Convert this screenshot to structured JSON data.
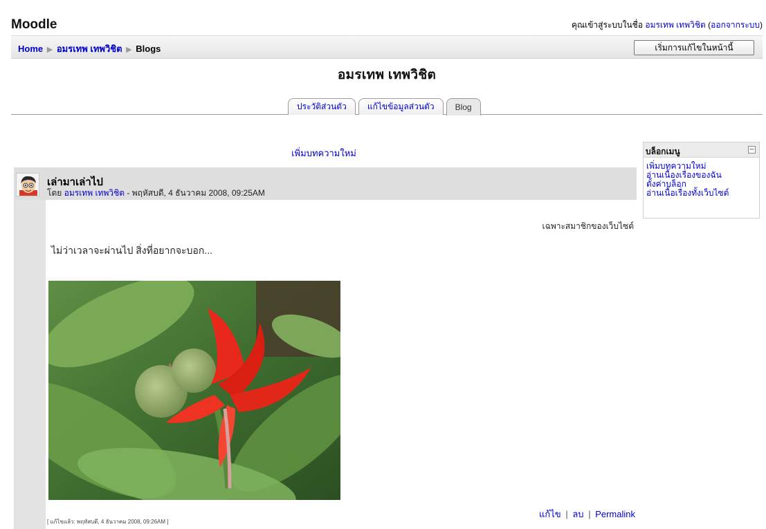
{
  "site": {
    "logo": "Moodle",
    "login_prefix": "คุณเข้าสู่ระบบในชื่อ",
    "login_user": "อมรเทพ เทพวิชิต",
    "logout_label": "ออกจากระบบ"
  },
  "navbar": {
    "breadcrumb": [
      {
        "label": "Home"
      },
      {
        "label": "อมรเทพ เทพวิชิต"
      },
      {
        "label": "Blogs"
      }
    ],
    "separator": "▶",
    "edit_button": "เริ่มการแก้ไขในหน้านี้"
  },
  "page": {
    "title": "อมรเทพ เทพวิชิต"
  },
  "tabs": [
    {
      "label": "ประวัติส่วนตัว",
      "active": false
    },
    {
      "label": "แก้ไขข้อมูลส่วนตัว",
      "active": false
    },
    {
      "label": "Blog",
      "active": true
    }
  ],
  "main": {
    "add_post": "เพิ่มบทความใหม่"
  },
  "post": {
    "title": "เล่ามาเล่าไป",
    "by_label": "โดย",
    "author": "อมรเทพ เทพวิชิต",
    "date": "- พฤหัสบดี, 4 ธันวาคม 2008, 09:25AM",
    "visibility": "เฉพาะสมาชิกของเว็บไซต์",
    "body": "ไม่ว่าเวลาจะผ่านไป สิ่งที่อยากจะบอก...",
    "actions": {
      "edit": "แก้ไข",
      "delete": "ลบ",
      "permalink": "Permalink",
      "separator": "|"
    },
    "last_edited": "[ แก้ไขแล้ว: พฤหัสบดี, 4 ธันวาคม 2008, 09:26AM ]"
  },
  "blog_menu": {
    "title": "บล็อกเมนู",
    "collapse_symbol": "−",
    "items": [
      {
        "label": "เพิ่มบทความใหม่"
      },
      {
        "label": "อ่านเนื้องเรื่องของฉัน"
      },
      {
        "label": "ตั้งค่าบล็อก"
      },
      {
        "label": "อ่านเนื้อเรื่องทั้งเว็บไซต์"
      }
    ]
  },
  "colors": {
    "link": "#0000cc",
    "post_header_bg": "#dedede",
    "flower_red": "#e8281a",
    "leaf_green": "#4f8a3a"
  },
  "icons": {
    "avatar": "cartoon-avatar-icon",
    "collapse": "collapse-icon"
  }
}
